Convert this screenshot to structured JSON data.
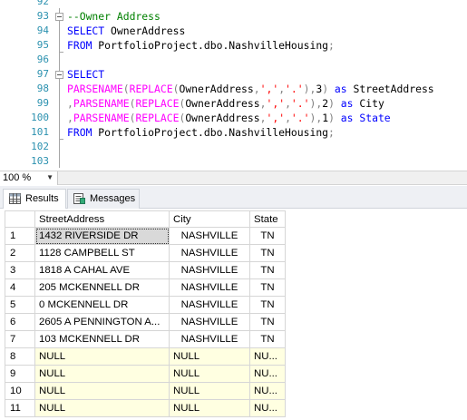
{
  "editor": {
    "lines": [
      {
        "num": "92",
        "tokens": []
      },
      {
        "num": "93",
        "tokens": [
          {
            "t": "--Owner Address",
            "c": "cmt"
          }
        ]
      },
      {
        "num": "94",
        "tokens": [
          {
            "t": "SELECT",
            "c": "kw"
          },
          {
            "t": " OwnerAddress",
            "c": ""
          }
        ]
      },
      {
        "num": "95",
        "tokens": [
          {
            "t": "FROM",
            "c": "kw"
          },
          {
            "t": " PortfolioProject.dbo.NashvilleHousing",
            "c": ""
          },
          {
            "t": ";",
            "c": "gray"
          }
        ]
      },
      {
        "num": "96",
        "tokens": []
      },
      {
        "num": "97",
        "tokens": [
          {
            "t": "SELECT",
            "c": "kw"
          }
        ]
      },
      {
        "num": "98",
        "tokens": [
          {
            "t": "PARSENAME",
            "c": "fn"
          },
          {
            "t": "(",
            "c": "gray"
          },
          {
            "t": "REPLACE",
            "c": "fn"
          },
          {
            "t": "(",
            "c": "gray"
          },
          {
            "t": "OwnerAddress",
            "c": ""
          },
          {
            "t": ",",
            "c": "gray"
          },
          {
            "t": "','",
            "c": "str"
          },
          {
            "t": ",",
            "c": "gray"
          },
          {
            "t": "'.'",
            "c": "str"
          },
          {
            "t": "),",
            "c": "gray"
          },
          {
            "t": "3",
            "c": ""
          },
          {
            "t": ")",
            "c": "gray"
          },
          {
            "t": " as",
            "c": "kw"
          },
          {
            "t": " StreetAddress",
            "c": ""
          }
        ]
      },
      {
        "num": "99",
        "tokens": [
          {
            "t": ",",
            "c": "gray"
          },
          {
            "t": "PARSENAME",
            "c": "fn"
          },
          {
            "t": "(",
            "c": "gray"
          },
          {
            "t": "REPLACE",
            "c": "fn"
          },
          {
            "t": "(",
            "c": "gray"
          },
          {
            "t": "OwnerAddress",
            "c": ""
          },
          {
            "t": ",",
            "c": "gray"
          },
          {
            "t": "','",
            "c": "str"
          },
          {
            "t": ",",
            "c": "gray"
          },
          {
            "t": "'.'",
            "c": "str"
          },
          {
            "t": "),",
            "c": "gray"
          },
          {
            "t": "2",
            "c": ""
          },
          {
            "t": ")",
            "c": "gray"
          },
          {
            "t": " as",
            "c": "kw"
          },
          {
            "t": " City",
            "c": ""
          }
        ]
      },
      {
        "num": "100",
        "tokens": [
          {
            "t": ",",
            "c": "gray"
          },
          {
            "t": "PARSENAME",
            "c": "fn"
          },
          {
            "t": "(",
            "c": "gray"
          },
          {
            "t": "REPLACE",
            "c": "fn"
          },
          {
            "t": "(",
            "c": "gray"
          },
          {
            "t": "OwnerAddress",
            "c": ""
          },
          {
            "t": ",",
            "c": "gray"
          },
          {
            "t": "','",
            "c": "str"
          },
          {
            "t": ",",
            "c": "gray"
          },
          {
            "t": "'.'",
            "c": "str"
          },
          {
            "t": "),",
            "c": "gray"
          },
          {
            "t": "1",
            "c": ""
          },
          {
            "t": ")",
            "c": "gray"
          },
          {
            "t": " as",
            "c": "kw"
          },
          {
            "t": " State",
            "c": "kw"
          }
        ]
      },
      {
        "num": "101",
        "tokens": [
          {
            "t": "FROM",
            "c": "kw"
          },
          {
            "t": " PortfolioProject.dbo.NashvilleHousing",
            "c": ""
          },
          {
            "t": ";",
            "c": "gray"
          }
        ]
      },
      {
        "num": "102",
        "tokens": []
      },
      {
        "num": "103",
        "tokens": []
      }
    ]
  },
  "zoom": {
    "value": "100 %",
    "arrow_icon": "chevron-down-icon"
  },
  "tabs": [
    {
      "label": "Results",
      "icon": "grid-icon",
      "active": true
    },
    {
      "label": "Messages",
      "icon": "messages-icon",
      "active": false
    }
  ],
  "grid": {
    "columns": [
      "StreetAddress",
      "City",
      "State"
    ],
    "rows": [
      {
        "n": "1",
        "cells": [
          "1432  RIVERSIDE DR",
          "NASHVILLE",
          "TN"
        ]
      },
      {
        "n": "2",
        "cells": [
          "1128  CAMPBELL ST",
          "NASHVILLE",
          "TN"
        ]
      },
      {
        "n": "3",
        "cells": [
          "1818 A CAHAL AVE",
          "NASHVILLE",
          "TN"
        ]
      },
      {
        "n": "4",
        "cells": [
          "205  MCKENNELL DR",
          "NASHVILLE",
          "TN"
        ]
      },
      {
        "n": "5",
        "cells": [
          "0  MCKENNELL DR",
          "NASHVILLE",
          "TN"
        ]
      },
      {
        "n": "6",
        "cells": [
          "2605 A PENNINGTON A...",
          "NASHVILLE",
          "TN"
        ]
      },
      {
        "n": "7",
        "cells": [
          "103  MCKENNELL DR",
          "NASHVILLE",
          "TN"
        ]
      },
      {
        "n": "8",
        "cells": [
          "NULL",
          "NULL",
          "NU..."
        ]
      },
      {
        "n": "9",
        "cells": [
          "NULL",
          "NULL",
          "NU..."
        ]
      },
      {
        "n": "10",
        "cells": [
          "NULL",
          "NULL",
          "NU..."
        ]
      },
      {
        "n": "11",
        "cells": [
          "NULL",
          "NULL",
          "NU..."
        ]
      }
    ],
    "selected_row": 1,
    "colors": {
      "null_bg": "#ffffe1",
      "selected_bg": "#d9d9d9"
    }
  }
}
